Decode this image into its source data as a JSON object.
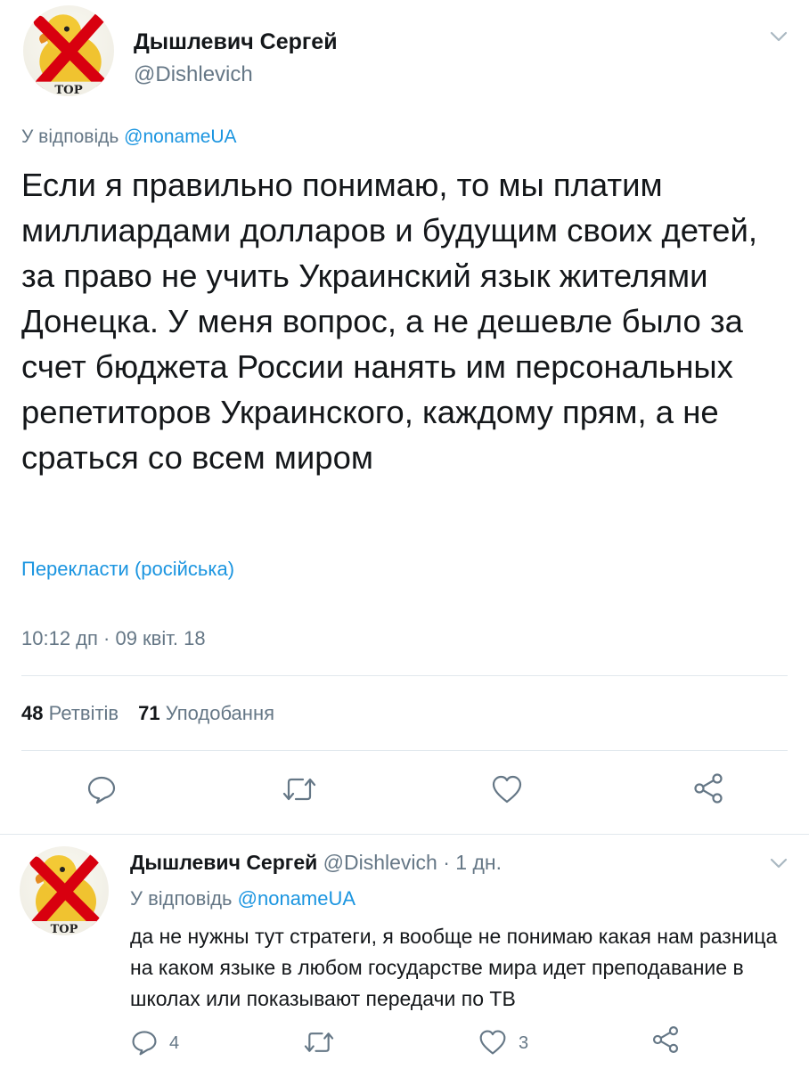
{
  "main_tweet": {
    "author_name": "Дышлевич Сергей",
    "author_handle": "@Dishlevich",
    "avatar_text": "ТОР",
    "reply_prefix": "У відповідь",
    "reply_to": "@nonameUA",
    "text": "Если я правильно понимаю, то мы платим миллиардами долларов и будущим своих детей, за право не учить Украинский язык жителями Донецка. У меня вопрос, а не дешевле было за счет бюджета России нанять им персональных репетиторов Украинского, каждому прям, а не сраться со всем миром",
    "translate_link": "Перекласти (російська)",
    "timestamp": "10:12 дп · 09 квіт. 18",
    "retweets_count": "48",
    "retweets_label": "Ретвітів",
    "likes_count": "71",
    "likes_label": "Уподобання"
  },
  "reply_tweet": {
    "author_name": "Дышлевич Сергей",
    "author_handle": "@Dishlevich",
    "time_ago": "· 1 дн.",
    "avatar_text": "ТОР",
    "reply_prefix": "У відповідь",
    "reply_to": "@nonameUA",
    "text": "да не нужны тут стратеги, я вообще не понимаю какая нам разница на каком языке в любом государстве мира  идет преподавание в школах или показывают передачи по ТВ",
    "replies_count": "4",
    "likes_count": "3"
  },
  "icons": {
    "reply": "reply-icon",
    "retweet": "retweet-icon",
    "like": "heart-icon",
    "share": "share-icon",
    "menu": "chevron-down-icon"
  },
  "colors": {
    "link": "#1b95e0",
    "secondary_text": "#657786",
    "primary_text": "#14171a",
    "avatar_cross": "#d8000f",
    "avatar_duck": "#f0c330"
  }
}
